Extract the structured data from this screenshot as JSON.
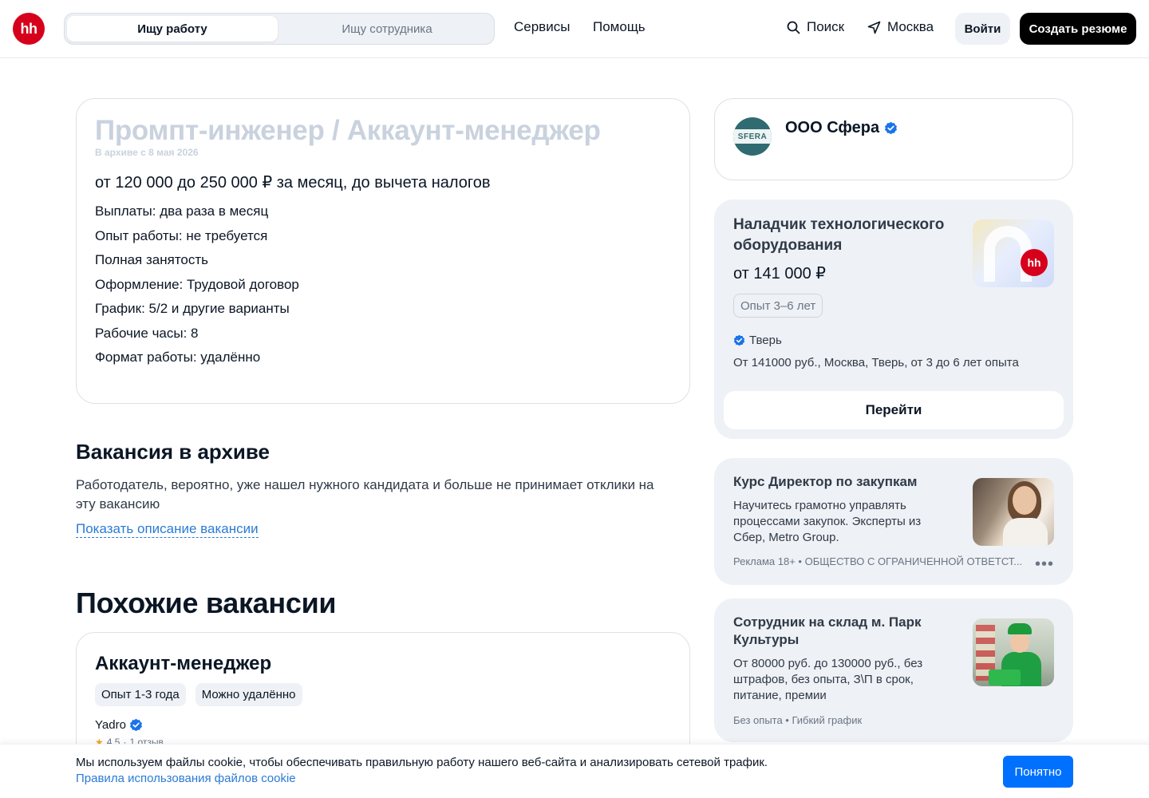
{
  "header": {
    "logo_text": "hh",
    "switch_job": "Ищу работу",
    "switch_employee": "Ищу сотрудника",
    "nav": [
      "Сервисы",
      "Помощь"
    ],
    "search_label": "Поиск",
    "city_label": "Москва",
    "login_label": "Войти",
    "create_resume_label": "Создать резюме"
  },
  "vacancy": {
    "title": "Промпт-инженер / Аккаунт-менеджер",
    "archived_note": "В архиве с 8 мая 2026",
    "salary": "от 120 000 до 250 000 ₽ за месяц, до вычета налогов",
    "facts": [
      "Выплаты: два раза в месяц",
      "Опыт работы: не требуется",
      "Полная занятость",
      "Оформление: Трудовой договор",
      "График: 5/2 и другие варианты",
      "Рабочие часы: 8",
      "Формат работы: удалённо"
    ]
  },
  "archive": {
    "heading": "Вакансия в архиве",
    "text": "Работодатель, вероятно, уже нашел нужного кандидата и больше не принимает отклики на эту вакансию",
    "link": "Показать описание вакансии"
  },
  "similar": {
    "heading": "Похожие вакансии",
    "card": {
      "title": "Аккаунт-менеджер",
      "tags": [
        "Опыт 1-3 года",
        "Можно удалённо"
      ],
      "company": "Yadro",
      "rating": "4.5",
      "reviews": "1 отзыв"
    }
  },
  "company": {
    "name": "ООО Сфера",
    "logo_text": "SFERA"
  },
  "ad1": {
    "title": "Наладчик технологического оборудования",
    "price": "от 141 000  ₽",
    "tag": "Опыт 3–6 лет",
    "city": "Тверь",
    "desc": "От 141000 руб., Москва, Тверь, от 3 до 6 лет опыта",
    "button": "Перейти",
    "badge": "hh"
  },
  "ad2": {
    "title": "Курс Директор по закупкам",
    "text": "Научитесь грамотно управлять процессами закупок. Эксперты из Сбер, Metro Group.",
    "meta": "Реклама 18+ • ОБЩЕСТВО С ОГРАНИЧЕННОЙ ОТВЕТСТ...",
    "more": "•••"
  },
  "ad3": {
    "title": "Сотрудник на склад м. Парк Культуры",
    "text": "От 80000 руб. до 130000 руб., без штрафов, без опыта, З\\П в срок, питание, премии",
    "meta": "Без опыта  •  Гибкий график"
  },
  "cookie": {
    "text": "Мы используем файлы cookie, чтобы обеспечивать правильную работу нашего веб-сайта и анализировать сетевой трафик.",
    "link": "Правила использования файлов cookie",
    "button": "Понятно"
  },
  "colors": {
    "brand_red": "#d6001c",
    "link_blue": "#2a7bd6",
    "button_blue": "#0070ff",
    "verified_blue": "#1a73e8"
  }
}
